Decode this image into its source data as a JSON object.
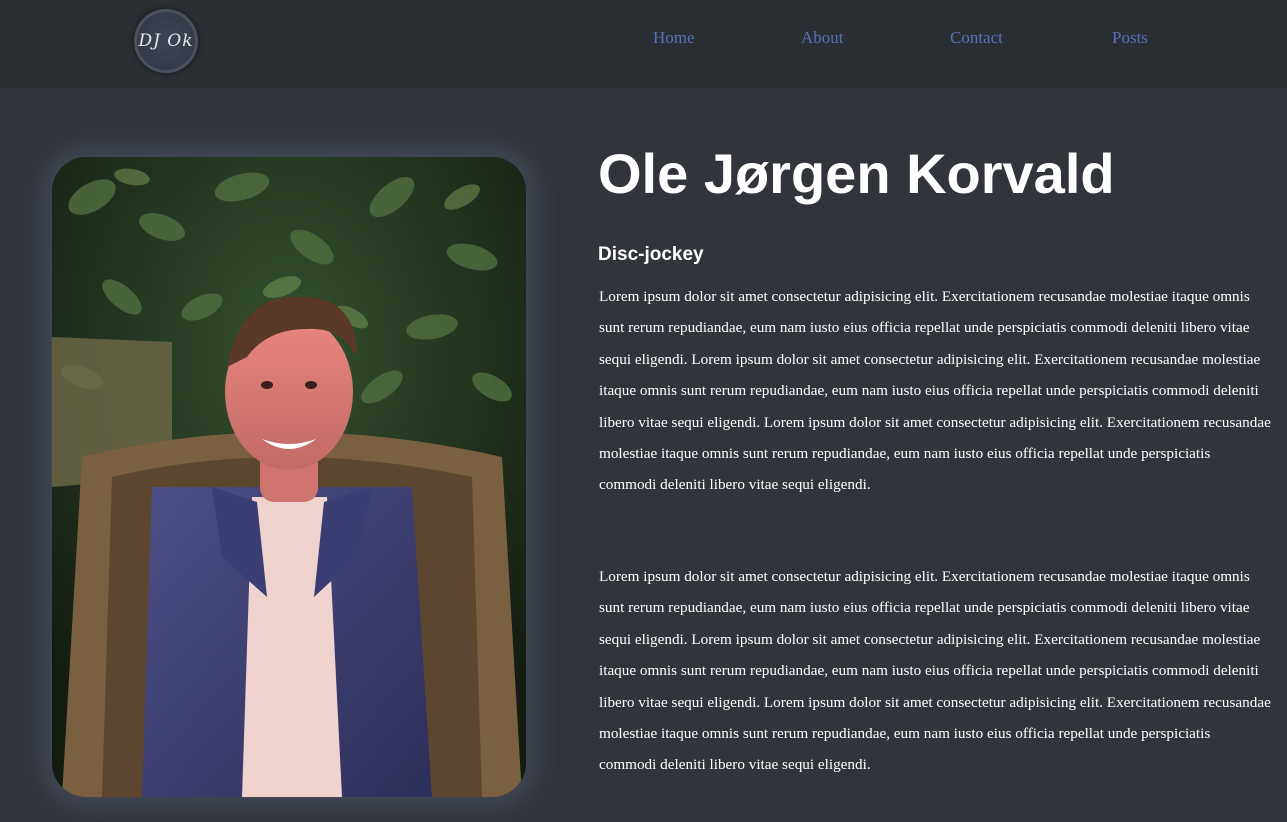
{
  "logo": {
    "text": "DJ Ok",
    "icon": "dj-ok-logo"
  },
  "nav": {
    "items": [
      {
        "label": "Home"
      },
      {
        "label": "About"
      },
      {
        "label": "Contact"
      },
      {
        "label": "Posts"
      }
    ]
  },
  "profile": {
    "name": "Ole Jørgen Korvald",
    "role": "Disc-jockey",
    "paragraphs": [
      "Lorem ipsum dolor sit amet consectetur adipisicing elit. Exercitationem recusandae molestiae itaque omnis sunt rerum repudiandae, eum nam iusto eius officia repellat unde perspiciatis commodi deleniti libero vitae sequi eligendi. Lorem ipsum dolor sit amet consectetur adipisicing elit. Exercitationem recusandae molestiae itaque omnis sunt rerum repudiandae, eum nam iusto eius officia repellat unde perspiciatis commodi deleniti libero vitae sequi eligendi. Lorem ipsum dolor sit amet consectetur adipisicing elit. Exercitationem recusandae molestiae itaque omnis sunt rerum repudiandae, eum nam iusto eius officia repellat unde perspiciatis commodi deleniti libero vitae sequi eligendi.",
      "Lorem ipsum dolor sit amet consectetur adipisicing elit. Exercitationem recusandae molestiae itaque omnis sunt rerum repudiandae, eum nam iusto eius officia repellat unde perspiciatis commodi deleniti libero vitae sequi eligendi. Lorem ipsum dolor sit amet consectetur adipisicing elit. Exercitationem recusandae molestiae itaque omnis sunt rerum repudiandae, eum nam iusto eius officia repellat unde perspiciatis commodi deleniti libero vitae sequi eligendi. Lorem ipsum dolor sit amet consectetur adipisicing elit. Exercitationem recusandae molestiae itaque omnis sunt rerum repudiandae, eum nam iusto eius officia repellat unde perspiciatis commodi deleniti libero vitae sequi eligendi."
    ]
  },
  "colors": {
    "page_background": "#31353b",
    "nav_background": "#2b2e33",
    "nav_link": "#5670b8",
    "text": "#ffffff"
  }
}
